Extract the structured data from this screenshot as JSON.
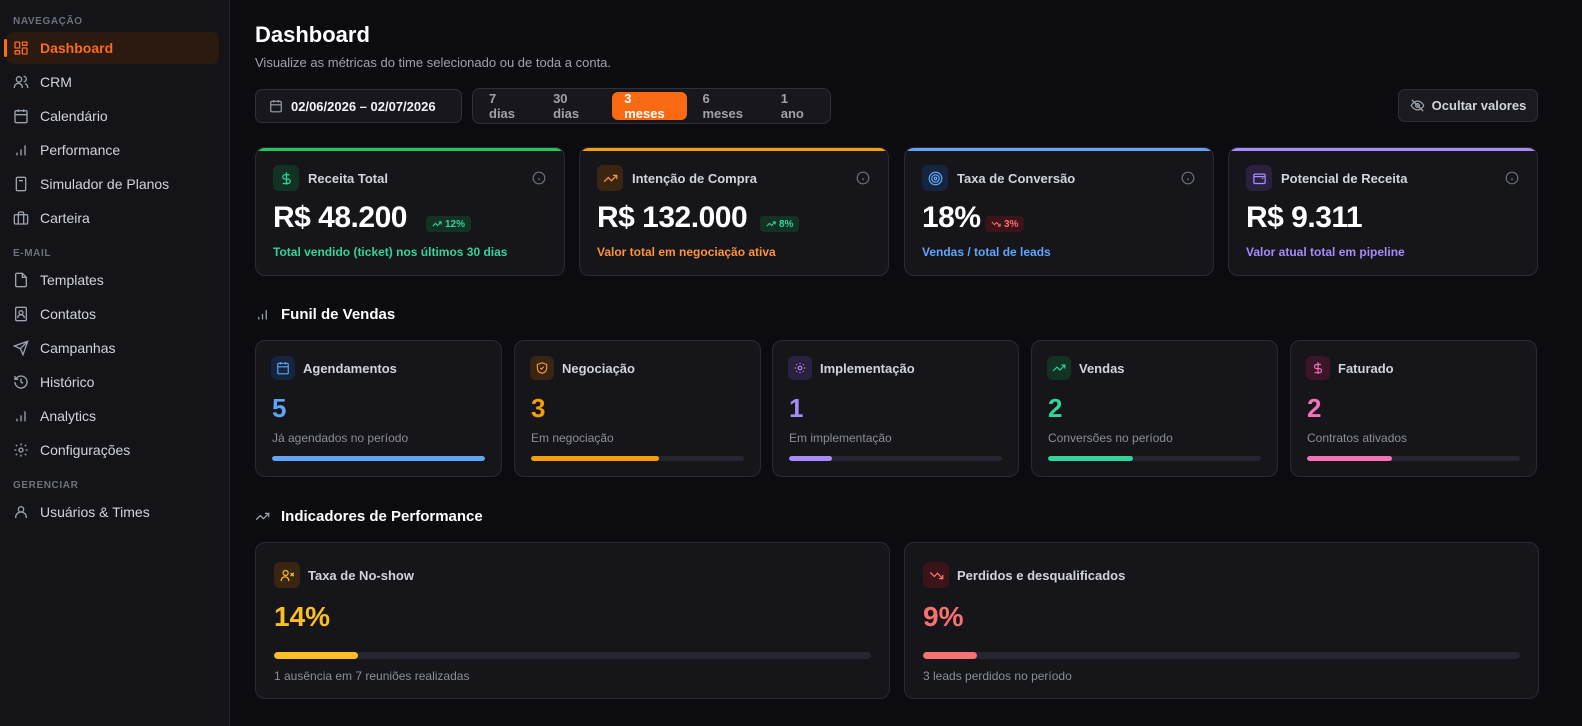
{
  "sidebar": {
    "sections": [
      {
        "label": "NAVEGAÇÃO"
      },
      {
        "label": "E-MAIL"
      },
      {
        "label": "GERENCIAR"
      }
    ],
    "items": [
      {
        "label": "Dashboard",
        "icon": "dashboard-icon"
      },
      {
        "label": "CRM",
        "icon": "users-icon"
      },
      {
        "label": "Calendário",
        "icon": "calendar-icon"
      },
      {
        "label": "Performance",
        "icon": "bar-chart-icon"
      },
      {
        "label": "Simulador de Planos",
        "icon": "calculator-icon"
      },
      {
        "label": "Carteira",
        "icon": "briefcase-icon"
      },
      {
        "label": "Templates",
        "icon": "file-icon"
      },
      {
        "label": "Contatos",
        "icon": "contact-icon"
      },
      {
        "label": "Campanhas",
        "icon": "send-icon"
      },
      {
        "label": "Histórico",
        "icon": "history-icon"
      },
      {
        "label": "Analytics",
        "icon": "bar-chart-icon"
      },
      {
        "label": "Configurações",
        "icon": "gear-icon"
      },
      {
        "label": "Usuários & Times",
        "icon": "user-icon"
      }
    ],
    "active": "Dashboard"
  },
  "header": {
    "title": "Dashboard",
    "subtitle": "Visualize as métricas do time selecionado ou de toda a conta."
  },
  "filters": {
    "date_range": "02/06/2026 – 02/07/2026",
    "periods": [
      "7 dias",
      "30 dias",
      "3 meses",
      "6 meses",
      "1 ano"
    ],
    "active_period": "3 meses",
    "hide_values_label": "Ocultar valores"
  },
  "kpis": [
    {
      "title": "Receita Total",
      "value": "R$ 48.200",
      "badge": "12%",
      "trend": "up",
      "desc": "Total vendido (ticket) nos últimos 30 dias",
      "color": "#22c55e",
      "icon": "dollar-icon"
    },
    {
      "title": "Intenção de Compra",
      "value": "R$ 132.000",
      "badge": "8%",
      "trend": "up",
      "desc": "Valor total em negociação ativa",
      "color": "#f59e0b",
      "icon": "trending-up-icon"
    },
    {
      "title": "Taxa de Conversão",
      "value": "18%",
      "badge": "3%",
      "trend": "down",
      "desc": "Vendas / total de leads",
      "color": "#60a5fa",
      "icon": "target-icon"
    },
    {
      "title": "Potencial de Receita",
      "value": "R$ 9.311",
      "badge": "",
      "trend": "",
      "desc": "Valor atual total em pipeline",
      "color": "#a78bfa",
      "icon": "wallet-icon"
    }
  ],
  "funnel": {
    "title": "Funil de Vendas",
    "stages": [
      {
        "title": "Agendamentos",
        "value": "5",
        "desc": "Já agendados no período",
        "fraction": 1.0,
        "color": "#60a5fa",
        "icon": "calendar-icon"
      },
      {
        "title": "Negociação",
        "value": "3",
        "desc": "Em negociação",
        "fraction": 0.6,
        "color": "#f59e0b",
        "icon": "handshake-icon"
      },
      {
        "title": "Implementação",
        "value": "1",
        "desc": "Em implementação",
        "fraction": 0.2,
        "color": "#a78bfa",
        "icon": "sparkle-icon"
      },
      {
        "title": "Vendas",
        "value": "2",
        "desc": "Conversões no período",
        "fraction": 0.4,
        "color": "#34d399",
        "icon": "trending-up-icon"
      },
      {
        "title": "Faturado",
        "value": "2",
        "desc": "Contratos ativados",
        "fraction": 0.4,
        "color": "#f472b6",
        "icon": "dollar-icon"
      }
    ]
  },
  "performance": {
    "title": "Indicadores de Performance",
    "cards": [
      {
        "title": "Taxa de No-show",
        "value": "14%",
        "fraction": 0.14,
        "desc": "1 ausência em 7 reuniões realizadas",
        "color": "#fbbf24",
        "icon": "user-x-icon"
      },
      {
        "title": "Perdidos e desqualificados",
        "value": "9%",
        "fraction": 0.09,
        "desc": "3 leads perdidos no período",
        "color": "#f87171",
        "icon": "trending-down-icon"
      }
    ]
  }
}
